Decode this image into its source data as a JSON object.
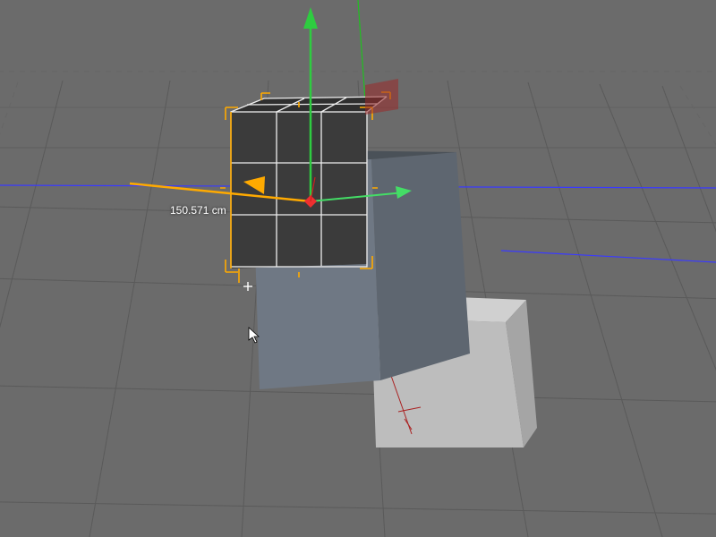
{
  "measurement": {
    "value": "150.571 cm"
  },
  "scene": {
    "selected_object": "Cube (subdivided 3x3)",
    "measurement_value_cm": 150.571,
    "gizmo_axes": {
      "x": "#ff3030",
      "y": "#30ff30",
      "z": "#3050ff"
    },
    "selection_outline_color": "#ffaa00"
  }
}
